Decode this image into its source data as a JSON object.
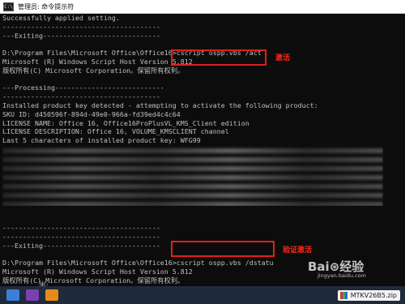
{
  "window": {
    "title": "管理员: 命令提示符"
  },
  "console": {
    "lines": [
      "Successfully applied setting.",
      "---------------------------------------",
      "---Exiting-----------------------------",
      "",
      "D:\\Program Files\\Microsoft Office\\Office16>cscript ospp.vbs /act",
      "Microsoft (R) Windows Script Host Version 5.812",
      "版权所有(C) Microsoft Corporation。保留所有权利。",
      "",
      "---Processing---------------------------",
      "---------------------------------------",
      "Installed product key detected - attempting to activate the following product:",
      "SKU ID: d450596f-894d-49e0-966a-fd39ed4c4c64",
      "LICENSE NAME: Office 16, Office16ProPlusVL_KMS_Client edition",
      "LICENSE DESCRIPTION: Office 16, VOLUME_KMSCLIENT channel",
      "Last 5 characters of installed product key: WFG99",
      "",
      "",
      "",
      "",
      "",
      "",
      "",
      "",
      "",
      "---------------------------------------",
      "---------------------------------------",
      "---Exiting-----------------------------",
      "",
      "D:\\Program Files\\Microsoft Office\\Office16>cscript ospp.vbs /dstatu",
      "Microsoft (R) Windows Script Host Version 5.812",
      "版权所有(C) Microsoft Corporation。保留所有权利。"
    ]
  },
  "annotations": {
    "activate": "激活",
    "verify": "验证激活"
  },
  "taskbar": {
    "ime_text": "半:",
    "file_name": "MTKV26B5.zip"
  },
  "watermark": {
    "brand": "Bai⊛经验",
    "url": "jingyan.baidu.com"
  },
  "colors": {
    "console_bg": "#0c0c0c",
    "console_text": "#c0c0c0",
    "highlight": "#e0201a"
  }
}
